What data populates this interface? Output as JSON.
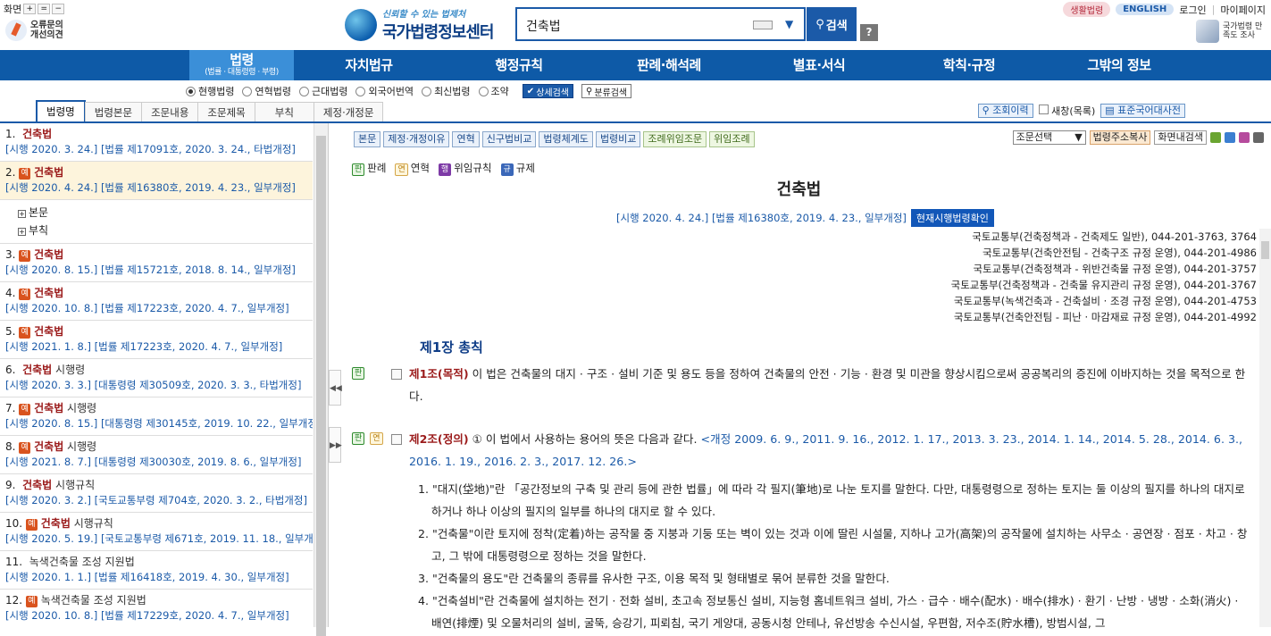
{
  "header": {
    "screen_label": "화면",
    "zoom_in": "+",
    "zoom_reset": "=",
    "zoom_out": "−",
    "error_report": "오류문의 개선의견",
    "logo_tagline": "신뢰할 수 있는 법제처",
    "logo_name": "국가법령정보센터",
    "search_value": "건축법",
    "search_button": "검색",
    "help": "?",
    "life_law": "생활법령",
    "english": "ENGLISH",
    "login": "로그인",
    "mypage": "마이페이지",
    "satisfaction": "국가법령 만족도 조사"
  },
  "nav": {
    "active_label": "법령",
    "active_sub": "(법률 · 대통령령 · 부령)",
    "items": [
      "자치법규",
      "행정규칙",
      "판례·해석례",
      "별표·서식",
      "학칙·규정",
      "그밖의 정보"
    ]
  },
  "filters": {
    "radios": [
      "현행법령",
      "연혁법령",
      "근대법령",
      "외국어번역",
      "최신법령",
      "조약"
    ],
    "selected": "현행법령",
    "detail_search": "상세검색",
    "category_search": "분류검색"
  },
  "tabs": [
    "법령명",
    "법령본문",
    "조문내용",
    "조문제목",
    "부칙",
    "제정·개정문"
  ],
  "active_tab": "법령명",
  "right_tools": {
    "history": "조회이력",
    "new_window": "새창(목록)",
    "dictionary": "표준국어대사전"
  },
  "results": [
    {
      "num": "1.",
      "pre": false,
      "name": "건축법",
      "suffix": "",
      "sub": "[시행 2020. 3. 24.] [법률 제17091호, 2020. 3. 24., 타법개정]"
    },
    {
      "num": "2.",
      "pre": true,
      "name": "건축법",
      "suffix": "",
      "sub": "[시행 2020. 4. 24.] [법률 제16380호, 2019. 4. 23., 일부개정]"
    },
    {
      "num": "3.",
      "pre": true,
      "name": "건축법",
      "suffix": "",
      "sub": "[시행 2020. 8. 15.] [법률 제15721호, 2018. 8. 14., 일부개정]"
    },
    {
      "num": "4.",
      "pre": true,
      "name": "건축법",
      "suffix": "",
      "sub": "[시행 2020. 10. 8.] [법률 제17223호, 2020. 4. 7., 일부개정]"
    },
    {
      "num": "5.",
      "pre": true,
      "name": "건축법",
      "suffix": "",
      "sub": "[시행 2021. 1. 8.] [법률 제17223호, 2020. 4. 7., 일부개정]"
    },
    {
      "num": "6.",
      "pre": false,
      "name": "건축법",
      "suffix": " 시행령",
      "sub": "[시행 2020. 3. 3.] [대통령령 제30509호, 2020. 3. 3., 타법개정]"
    },
    {
      "num": "7.",
      "pre": true,
      "name": "건축법",
      "suffix": " 시행령",
      "sub": "[시행 2020. 8. 15.] [대통령령 제30145호, 2019. 10. 22., 일부개정]"
    },
    {
      "num": "8.",
      "pre": true,
      "name": "건축법",
      "suffix": " 시행령",
      "sub": "[시행 2021. 8. 7.] [대통령령 제30030호, 2019. 8. 6., 일부개정]"
    },
    {
      "num": "9.",
      "pre": false,
      "name": "건축법",
      "suffix": " 시행규칙",
      "sub": "[시행 2020. 3. 2.] [국토교통부령 제704호, 2020. 3. 2., 타법개정]"
    },
    {
      "num": "10.",
      "pre": true,
      "name": "건축법",
      "suffix": " 시행규칙",
      "sub": "[시행 2020. 5. 19.] [국토교통부령 제671호, 2019. 11. 18., 일부개정]"
    },
    {
      "num": "11.",
      "pre": false,
      "name": "",
      "suffix": "녹색건축물 조성 지원법",
      "sub": "[시행 2020. 1. 1.] [법률 제16418호, 2019. 4. 30., 일부개정]"
    },
    {
      "num": "12.",
      "pre": true,
      "name": "",
      "suffix": "녹색건축물 조성 지원법",
      "sub": "[시행 2020. 10. 8.] [법률 제17229호, 2020. 4. 7., 일부개정]"
    }
  ],
  "pre_badge": "예",
  "tree": [
    "본문",
    "부칙"
  ],
  "toolbar": {
    "buttons": [
      "본문",
      "제정·개정이유",
      "연혁",
      "신구법비교",
      "법령체계도",
      "법령비교"
    ],
    "green_buttons": [
      "조례위임조문",
      "위임조례"
    ],
    "article_select": "조문선택",
    "addr_copy": "법령주소복사",
    "screen_search": "화면내검색"
  },
  "legend": [
    {
      "tag": "판",
      "label": "판례"
    },
    {
      "tag": "연",
      "label": "연혁"
    },
    {
      "tag": "행",
      "label": "위임규칙"
    },
    {
      "tag": "규",
      "label": "규제"
    }
  ],
  "law": {
    "title": "건축법",
    "effective": "[시행 2020. 4. 24.] [법률 제16380호, 2019. 4. 23., 일부개정]",
    "current_btn": "현재시행법령확인",
    "departments": [
      "국토교통부(건축정책과 - 건축제도 일반), 044-201-3763, 3764",
      "국토교통부(건축안전팀 - 건축구조 규정 운영), 044-201-4986",
      "국토교통부(건축정책과 - 위반건축물 규정 운영), 044-201-3757",
      "국토교통부(건축정책과 - 건축물 유지관리 규정 운영), 044-201-3767",
      "국토교통부(녹색건축과 - 건축설비 · 조경 규정 운영), 044-201-4753",
      "국토교통부(건축안전팀 - 피난 · 마감재료 규정 운영), 044-201-4992"
    ],
    "chapter": "제1장 총칙",
    "art1_no": "제1조(목적)",
    "art1_text": " 이 법은 건축물의 대지 · 구조 · 설비 기준 및 용도 등을 정하여 건축물의 안전 · 기능 · 환경 및 미관을 향상시킴으로써 공공복리의 증진에 이바지하는 것을 목적으로 한다.",
    "art2_no": "제2조(정의)",
    "art2_text": " ① 이 법에서 사용하는 용어의 뜻은 다음과 같다.  ",
    "art2_amend": "<개정 2009. 6. 9., 2011. 9. 16., 2012. 1. 17., 2013. 3. 23., 2014. 1. 14., 2014. 5. 28., 2014. 6. 3., 2016. 1. 19., 2016. 2. 3., 2017. 12. 26.>",
    "items": [
      "1. \"대지(垈地)\"란 「공간정보의 구축 및 관리 등에 관한 법률」에 따라 각 필지(筆地)로 나눈 토지를 말한다. 다만, 대통령령으로 정하는 토지는 둘 이상의 필지를 하나의 대지로 하거나 하나 이상의 필지의 일부를 하나의 대지로 할 수 있다.",
      "2. \"건축물\"이란 토지에 정착(定着)하는 공작물 중 지붕과 기둥 또는 벽이 있는 것과 이에 딸린 시설물, 지하나 고가(高架)의 공작물에 설치하는 사무소 · 공연장 · 점포 · 차고 · 창고, 그 밖에 대통령령으로 정하는 것을 말한다.",
      "3. \"건축물의 용도\"란 건축물의 종류를 유사한 구조, 이용 목적 및 형태별로 묶어 분류한 것을 말한다.",
      "4. \"건축설비\"란 건축물에 설치하는 전기 · 전화 설비, 초고속 정보통신 설비, 지능형 홈네트워크 설비, 가스 · 급수 · 배수(配水) · 배수(排水) · 환기 · 난방 · 냉방 · 소화(消火) · 배연(排煙) 및 오물처리의 설비, 굴뚝, 승강기, 피뢰침, 국기 게양대, 공동시청 안테나, 유선방송 수신시설, 우편함, 저수조(貯水槽), 방범시설, 그"
    ]
  }
}
